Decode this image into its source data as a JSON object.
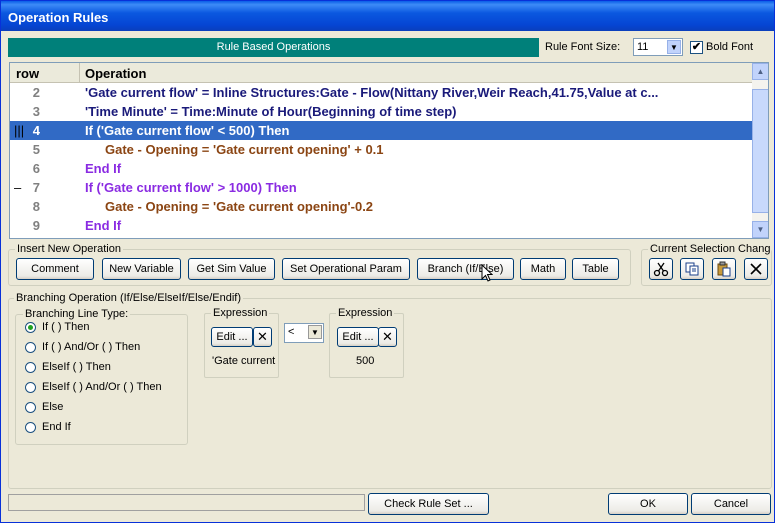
{
  "window": {
    "title": "Operation Rules"
  },
  "banner": {
    "text": "Rule Based Operations"
  },
  "font_options": {
    "size_label": "Rule Font Size:",
    "size_value": "11",
    "bold_label": "Bold Font",
    "bold_checked": true
  },
  "grid": {
    "columns": [
      "row",
      "Operation"
    ],
    "rows": [
      {
        "num": "2",
        "text": "'Gate current flow' = Inline Structures:Gate - Flow(Nittany River,Weir Reach,41.75,Value at c...",
        "indent": 0,
        "color": "#1a1a7a",
        "selected": false,
        "mark": ""
      },
      {
        "num": "3",
        "text": "'Time Minute' = Time:Minute of Hour(Beginning of time step)",
        "indent": 0,
        "color": "#1a1a7a",
        "selected": false,
        "mark": ""
      },
      {
        "num": "4",
        "text": "If ('Gate current flow' < 500) Then",
        "indent": 0,
        "color": "#8a2be2",
        "selected": true,
        "mark": "|||"
      },
      {
        "num": "5",
        "text": "Gate - Opening = 'Gate current opening' + 0.1",
        "indent": 1,
        "color": "#8b4513",
        "selected": false,
        "mark": ""
      },
      {
        "num": "6",
        "text": "End If",
        "indent": 0,
        "color": "#8a2be2",
        "selected": false,
        "mark": ""
      },
      {
        "num": "7",
        "text": "If ('Gate current flow' > 1000) Then",
        "indent": 0,
        "color": "#8a2be2",
        "selected": false,
        "mark": "–"
      },
      {
        "num": "8",
        "text": "Gate - Opening = 'Gate current opening'-0.2",
        "indent": 1,
        "color": "#8b4513",
        "selected": false,
        "mark": ""
      },
      {
        "num": "9",
        "text": "End If",
        "indent": 0,
        "color": "#8a2be2",
        "selected": false,
        "mark": ""
      }
    ]
  },
  "insert_group": {
    "legend": "Insert New Operation",
    "buttons": [
      "Comment",
      "New Variable",
      "Get Sim Value",
      "Set Operational Param",
      "Branch (If/Else)",
      "Math",
      "Table"
    ]
  },
  "selection_group": {
    "legend": "Current Selection Change",
    "icons": [
      "cut-icon",
      "copy-icon",
      "paste-icon",
      "delete-icon"
    ]
  },
  "branch_group": {
    "legend": "Branching Operation (If/Else/ElseIf/Else/Endif)",
    "line_type_legend": "Branching Line Type:",
    "options": [
      "If ( ) Then",
      "If ( ) And/Or ( ) Then",
      "ElseIf ( ) Then",
      "ElseIf ( ) And/Or ( ) Then",
      "Else",
      "End If"
    ],
    "selected_index": 0,
    "left_expr": {
      "legend": "Expression",
      "edit_label": "Edit ...",
      "value": "'Gate current"
    },
    "operator": "<",
    "right_expr": {
      "legend": "Expression",
      "edit_label": "Edit ...",
      "value": "500"
    }
  },
  "footer": {
    "check_label": "Check Rule Set ...",
    "ok_label": "OK",
    "cancel_label": "Cancel"
  },
  "colors": {
    "titlebar": "#0a5ee8",
    "banner": "#00807a",
    "selection": "#316ac5"
  }
}
